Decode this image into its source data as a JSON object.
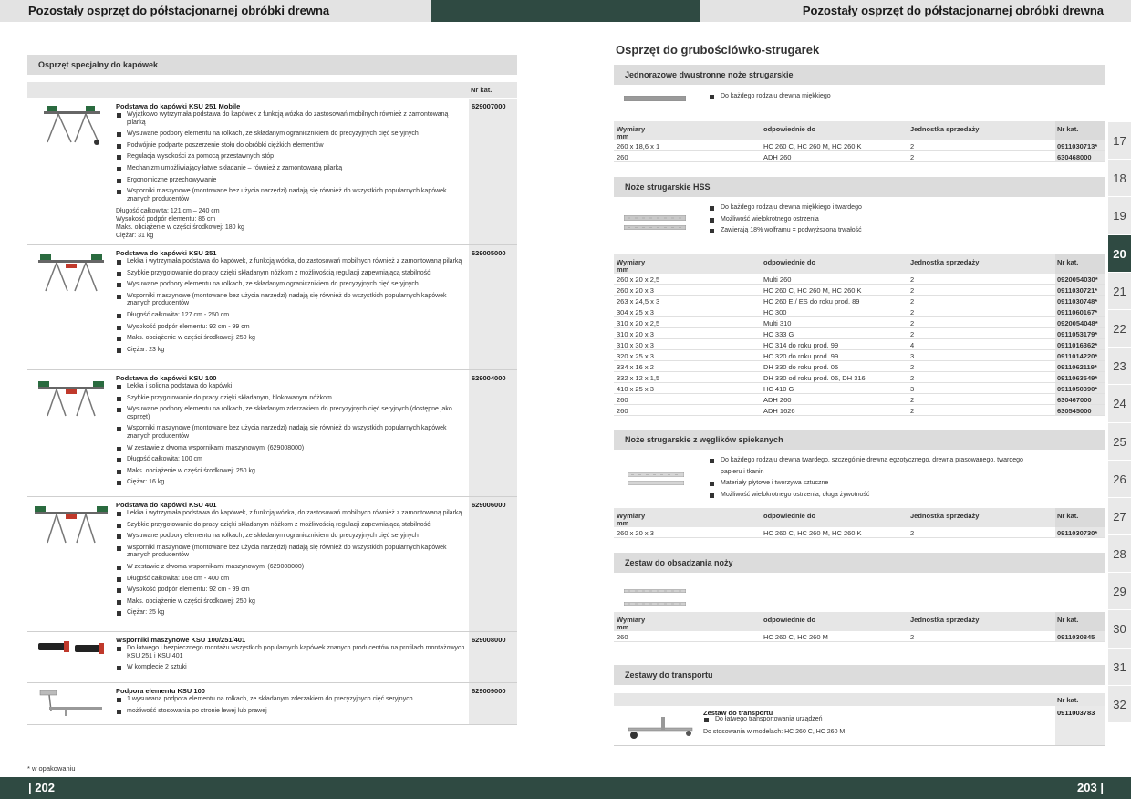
{
  "header": {
    "left_title": "Pozostały osprzęt do półstacjonarnej obróbki drewna",
    "right_title": "Pozostały osprzęt do półstacjonarnej obróbki drewna"
  },
  "footer": {
    "left_page": "| 202",
    "right_page": "203 |",
    "note": "* w opakowaniu"
  },
  "left": {
    "section_title": "Osprzęt specjalny do kapówek",
    "nr_header": "Nr kat.",
    "products": [
      {
        "title": "Podstawa do kapówki KSU 251 Mobile",
        "bullets": [
          "Wyjątkowo wytrzymała podstawa do kapówek z funkcją wózka do zastosowań mobilnych również z zamontowaną pilarką",
          "Wysuwane podpory elementu na rolkach, ze składanym ogranicznikiem do precyzyjnych cięć seryjnych",
          "Podwójnie podparte poszerzenie stołu do obróbki ciężkich elementów",
          "Regulacja wysokości za pomocą przestawnych stóp",
          "Mechanizm umożliwiający łatwe składanie – również z zamontowaną pilarką",
          "Ergonomiczne przechowywanie",
          "Wsporniki maszynowe (montowane bez użycia narzędzi) nadają się również do wszystkich popularnych kapówek znanych producentów"
        ],
        "plain": [
          "Długość całkowita: 121 cm – 240 cm",
          "Wysokość podpór elementu: 86 cm",
          "Maks. obciążenie w części środkowej: 180 kg",
          "Ciężar: 31 kg"
        ],
        "nr": "629007000"
      },
      {
        "title": "Podstawa do kapówki KSU 251",
        "bullets": [
          "Lekka i wytrzymała podstawa do kapówek, z funkcją wózka, do zastosowań mobilnych również z zamontowaną pilarką",
          "Szybkie przygotowanie do pracy dzięki składanym nóżkom z możliwością regulacji zapewniającą stabilność",
          "Wysuwane podpory elementu na rolkach, ze składanym ogranicznikiem do precyzyjnych cięć seryjnych",
          "Wsporniki maszynowe (montowane bez użycia narzędzi) nadają się również do wszystkich popularnych kapówek znanych producentów",
          "Długość całkowita: 127 cm - 250 cm",
          "Wysokość podpór elementu: 92 cm - 99 cm",
          "Maks. obciążenie w części środkowej: 250 kg",
          "Ciężar: 23 kg"
        ],
        "plain": [],
        "nr": "629005000"
      },
      {
        "title": "Podstawa do kapówki KSU 100",
        "bullets": [
          "Lekka i solidna podstawa do kapówki",
          "Szybkie przygotowanie do pracy dzięki składanym, blokowanym nóżkom",
          "Wysuwane podpory elementu na rolkach, ze składanym zderzakiem do precyzyjnych cięć seryjnych (dostępne jako osprzęt)",
          "Wsporniki maszynowe (montowane bez użycia narzędzi) nadają się również do wszystkich popularnych kapówek znanych producentów",
          "W zestawie z dwoma wspornikami maszynowymi (629008000)",
          "Długość całkowita: 100 cm",
          "Maks. obciążenie w części środkowej: 250 kg",
          "Ciężar: 16 kg"
        ],
        "plain": [],
        "nr": "629004000"
      },
      {
        "title": "Podstawa do kapówki KSU 401",
        "bullets": [
          "Lekka i wytrzymała podstawa do kapówek, z funkcją wózka, do zastosowań mobilnych również z zamontowaną pilarką",
          "Szybkie przygotowanie do pracy dzięki składanym nóżkom z możliwością regulacji zapewniającą stabilność",
          "Wysuwane podpory elementu na rolkach, ze składanym ogranicznikiem do precyzyjnych cięć seryjnych",
          "Wsporniki maszynowe (montowane bez użycia narzędzi) nadają się również do wszystkich popularnych kapówek znanych producentów",
          "W zestawie z dwoma wspornikami maszynowymi (629008000)",
          "Długość całkowita: 168 cm - 400 cm",
          "Wysokość podpór elementu: 92 cm - 99 cm",
          "Maks. obciążenie w części środkowej: 250 kg",
          "Ciężar: 25 kg"
        ],
        "plain": [],
        "nr": "629006000"
      },
      {
        "title": "Wsporniki maszynowe KSU 100/251/401",
        "bullets": [
          "Do łatwego i bezpiecznego montażu wszystkich popularnych kapówek znanych producentów na profilach montażowych KSU 251 i KSU 401",
          "W komplecie 2 sztuki"
        ],
        "plain": [],
        "nr": "629008000"
      },
      {
        "title": "Podpora elementu KSU 100",
        "bullets": [
          "1 wysuwana podpora elementu na rolkach, ze składanym zderzakiem do precyzyjnych cięć seryjnych",
          "możliwość stosowania po stronie lewej lub prawej"
        ],
        "plain": [],
        "nr": "629009000"
      }
    ]
  },
  "right": {
    "main_title": "Osprzęt do grubościówko-strugarek",
    "cols": {
      "a": "Wymiary",
      "a2": "mm",
      "b": "odpowiednie do",
      "c": "Jednostka sprzedaży",
      "d": "Nr kat."
    },
    "s1": {
      "title": "Jednorazowe dwustronne noże strugarskie",
      "bullets": [
        "Do każdego rodzaju drewna miękkiego"
      ],
      "rows": [
        [
          "260 x 18,6 x 1",
          "HC 260 C, HC 260 M, HC 260 K",
          "2",
          "0911030713*"
        ],
        [
          "260",
          "ADH 260",
          "2",
          "630468000"
        ]
      ]
    },
    "s2": {
      "title": "Noże strugarskie HSS",
      "bullets": [
        "Do każdego rodzaju drewna miękkiego i twardego",
        "Możliwość wielokrotnego ostrzenia",
        "Zawierają 18% wolframu = podwyższona trwałość"
      ],
      "rows": [
        [
          "260 x 20 x 2,5",
          "Multi 260",
          "2",
          "0920054030*"
        ],
        [
          "260 x 20 x 3",
          "HC 260 C, HC 260 M, HC 260 K",
          "2",
          "0911030721*"
        ],
        [
          "263 x 24,5 x 3",
          "HC 260 E / ES do roku prod. 89",
          "2",
          "0911030748*"
        ],
        [
          "304 x 25 x 3",
          "HC 300",
          "2",
          "0911060167*"
        ],
        [
          "310 x 20 x 2,5",
          "Multi 310",
          "2",
          "0920054048*"
        ],
        [
          "310 x 20 x 3",
          "HC 333 G",
          "2",
          "0911053179*"
        ],
        [
          "310 x 30 x 3",
          "HC 314 do roku prod. 99",
          "4",
          "0911016362*"
        ],
        [
          "320 x 25 x 3",
          "HC 320 do roku prod. 99",
          "3",
          "0911014220*"
        ],
        [
          "334 x 16 x 2",
          "DH 330 do roku prod. 05",
          "2",
          "0911062119*"
        ],
        [
          "332 x 12 x 1,5",
          "DH 330 od roku prod. 06, DH 316",
          "2",
          "0911063549*"
        ],
        [
          "410 x 25 x 3",
          "HC 410 G",
          "3",
          "0911050390*"
        ],
        [
          "260",
          "ADH 260",
          "2",
          "630467000"
        ],
        [
          "260",
          "ADH 1626",
          "2",
          "630545000"
        ]
      ]
    },
    "s3": {
      "title": "Noże strugarskie z węglików spiekanych",
      "bullets": [
        "Do każdego rodzaju drewna twardego, szczególnie drewna egzotycznego, drewna prasowanego, twardego papieru i tkanin",
        "Materiały płytowe i tworzywa sztuczne",
        "Możliwość wielokrotnego ostrzenia, długa żywotność"
      ],
      "rows": [
        [
          "260 x 20 x 3",
          "HC 260 C, HC 260 M, HC 260 K",
          "2",
          "0911030730*"
        ]
      ]
    },
    "s4": {
      "title": "Zestaw do obsadzania noży",
      "rows": [
        [
          "260",
          "HC 260 C, HC 260 M",
          "2",
          "0911030845"
        ]
      ]
    },
    "s5": {
      "title": "Zestawy do transportu",
      "nr_header": "Nr kat.",
      "item_title": "Zestaw do transportu",
      "bullet": "Do łatwego transportowania urządzeń",
      "plain": "Do stosowania w modelach: HC 260 C, HC 260 M",
      "nr": "0911003783"
    }
  },
  "tabs": [
    "17",
    "18",
    "19",
    "20",
    "21",
    "22",
    "23",
    "24",
    "25",
    "26",
    "27",
    "28",
    "29",
    "30",
    "31",
    "32"
  ],
  "active_tab": "20"
}
